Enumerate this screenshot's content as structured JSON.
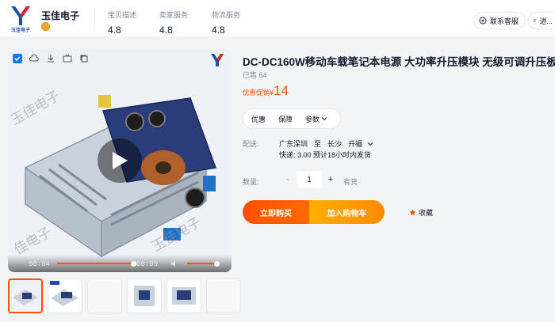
{
  "shop": {
    "name": "玉佳电子",
    "logo_text": "玉佳电子"
  },
  "scores": [
    {
      "label": "宝贝描述",
      "value": "4.8"
    },
    {
      "label": "卖家服务",
      "value": "4.8"
    },
    {
      "label": "物流服务",
      "value": "4.8"
    }
  ],
  "header_buttons": {
    "service": "联系客服",
    "enter_shop": "进..."
  },
  "gallery": {
    "time_current": "00:04",
    "time_total": "00:09",
    "progress_fraction": 0.45,
    "volume_fraction": 0.85,
    "watermark": "玉佳电子"
  },
  "product": {
    "title": "DC-DC160W移动车载笔记本电源 大功率升压模块 无级可调升压板",
    "sold": "已售 64",
    "promo_label": "优惠促销",
    "currency": "¥",
    "price": "14"
  },
  "tabs": [
    "优惠",
    "保障",
    "参数"
  ],
  "shipping": {
    "label": "配送:",
    "from": "广东深圳",
    "to_word": "至",
    "to": "长沙",
    "district": "开福",
    "detail": "快递: 3.00  预计18小时内发货"
  },
  "quantity": {
    "label": "数量:",
    "value": "1",
    "minus": "-",
    "plus": "+",
    "stock": "有货"
  },
  "actions": {
    "buy_now": "立即购买",
    "add_cart": "加入购物车",
    "favorite": "收藏"
  },
  "colors": {
    "accent": "#ff5000",
    "cart": "#ffa200",
    "star": "#ff5000"
  }
}
